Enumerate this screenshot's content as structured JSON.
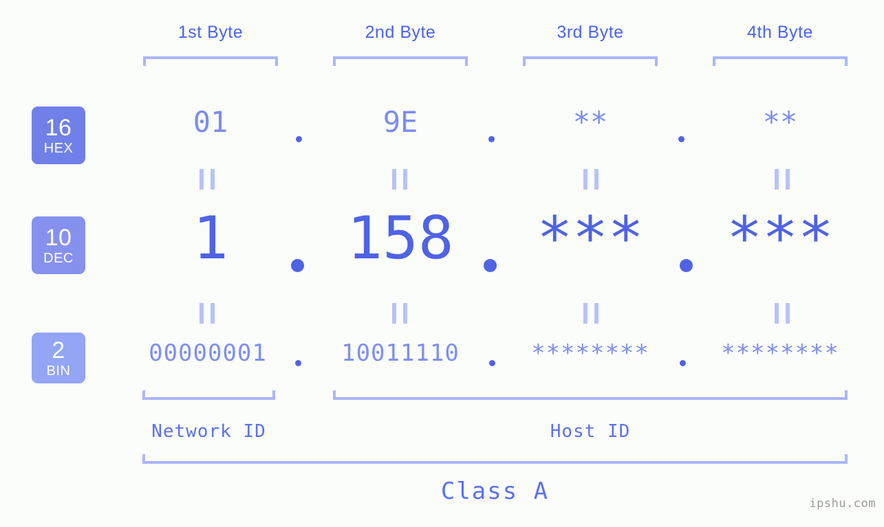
{
  "meta": {
    "watermark": "ipshu.com",
    "background_color": "#fbfdfa",
    "accent_strong": "#4f63e5",
    "accent_mid": "#7a8cf0",
    "accent_light": "#aab6f7"
  },
  "byte_headers": [
    {
      "label": "1st Byte"
    },
    {
      "label": "2nd Byte"
    },
    {
      "label": "3rd Byte"
    },
    {
      "label": "4th Byte"
    }
  ],
  "rows": [
    {
      "badge_number": "16",
      "badge_label": "HEX",
      "badge_color": "#7080e8",
      "values": [
        "01",
        "9E",
        "**",
        "**"
      ]
    },
    {
      "badge_number": "10",
      "badge_label": "DEC",
      "badge_color": "#8691ee",
      "values": [
        "1",
        "158",
        "***",
        "***"
      ]
    },
    {
      "badge_number": "2",
      "badge_label": "BIN",
      "badge_color": "#93a5f4",
      "values": [
        "00000001",
        "10011110",
        "********",
        "********"
      ]
    }
  ],
  "separators": {
    "glyph": ".",
    "count_per_row": 3
  },
  "equals_connector": {
    "glyph": "||",
    "rows": 2,
    "columns": 4
  },
  "segments": [
    {
      "label": "Network ID"
    },
    {
      "label": "Host ID"
    }
  ],
  "class": {
    "label": "Class A"
  }
}
